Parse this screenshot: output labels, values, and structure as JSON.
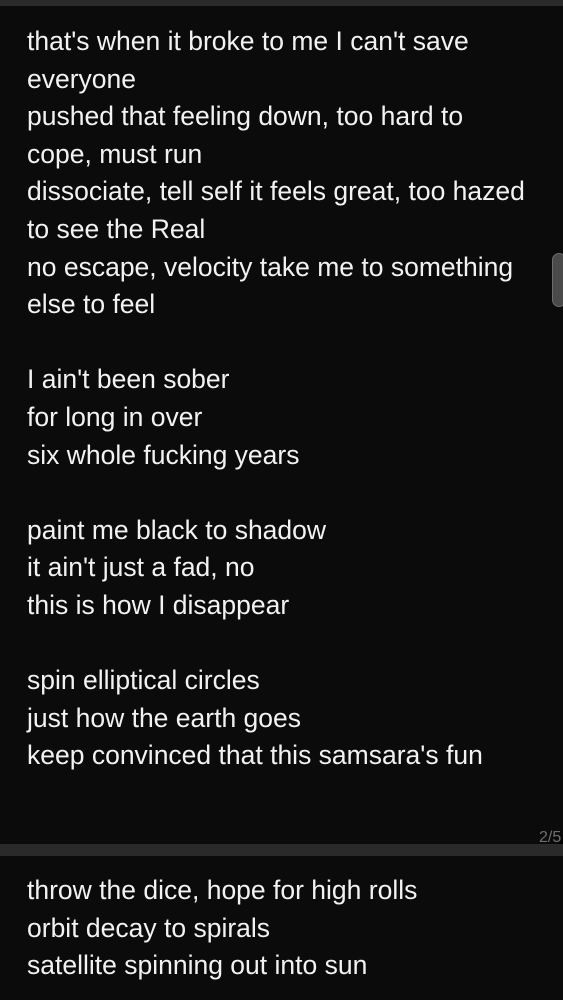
{
  "post_1": {
    "lines": [
      "that's when it broke to me I can't save",
      "everyone",
      "pushed that feeling down, too hard to",
      "cope, must run",
      "dissociate, tell self it feels great, too hazed",
      "to see the Real",
      "no escape, velocity take me to something",
      "else to feel",
      "",
      "I ain't been sober",
      "for long in over",
      "six whole fucking years",
      "",
      "paint me black to shadow",
      "it ain't just a fad, no",
      "this is how I disappear",
      "",
      "spin elliptical circles",
      "just how the earth goes",
      "keep convinced that this samsara's fun"
    ],
    "page_counter": "2/5"
  },
  "post_2": {
    "lines": [
      "throw the dice, hope for high rolls",
      "orbit decay to spirals",
      "satellite spinning out into sun"
    ]
  },
  "colors": {
    "background": "#000000",
    "card": "#0b0b0b",
    "separator": "#2a2a2a",
    "text": "#f2f2f2",
    "muted": "#6f6f6f"
  }
}
